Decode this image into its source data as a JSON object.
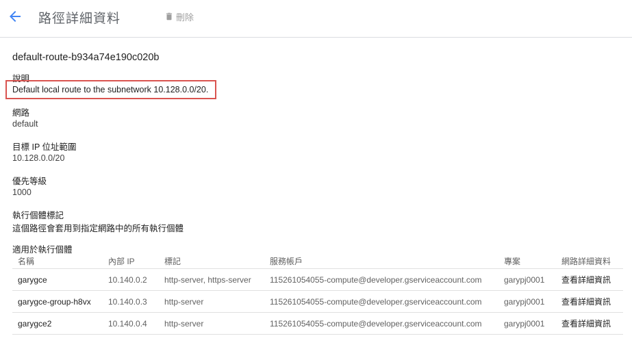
{
  "header": {
    "title": "路徑詳細資料",
    "delete_label": "刪除"
  },
  "route": {
    "name": "default-route-b934a74e190c020b",
    "description_label": "說明",
    "description": "Default local route to the subnetwork 10.128.0.0/20.",
    "network_label": "網路",
    "network": "default",
    "dest_label": "目標 IP 位址範圍",
    "dest": "10.128.0.0/20",
    "priority_label": "優先等級",
    "priority": "1000",
    "instance_tags_label": "執行個體標記",
    "instance_tags": "這個路徑會套用到指定網路中的所有執行個體",
    "applies_label": "適用於執行個體"
  },
  "table": {
    "headers": [
      "名稱",
      "內部 IP",
      "標記",
      "服務帳戶",
      "專案",
      "網路詳細資料"
    ],
    "rows": [
      {
        "name": "garygce",
        "ip": "10.140.0.2",
        "tags": "http-server, https-server",
        "account": "115261054055-compute@developer.gserviceaccount.com",
        "project": "garypj0001",
        "link": "查看詳細資訊"
      },
      {
        "name": "garygce-group-h8vx",
        "ip": "10.140.0.3",
        "tags": "http-server",
        "account": "115261054055-compute@developer.gserviceaccount.com",
        "project": "garypj0001",
        "link": "查看詳細資訊"
      },
      {
        "name": "garygce2",
        "ip": "10.140.0.4",
        "tags": "http-server",
        "account": "115261054055-compute@developer.gserviceaccount.com",
        "project": "garypj0001",
        "link": "查看詳細資訊"
      }
    ]
  },
  "colors": {
    "accent": "#4285f4",
    "highlight_border": "#d9534f"
  },
  "icons": {
    "back": "arrow-left-icon",
    "delete": "trash-icon"
  }
}
